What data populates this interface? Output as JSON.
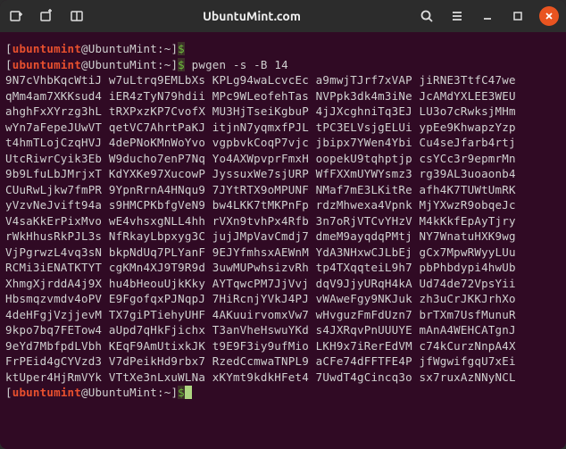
{
  "titlebar": {
    "title": "UbuntuMint.com"
  },
  "prompt": {
    "open": "[",
    "user": "ubuntumint",
    "at": "@",
    "host": "UbuntuMint",
    "colon": ":",
    "path": "~",
    "close": "]",
    "sigil": "$"
  },
  "command": " pwgen -s -B 14",
  "output_lines": [
    "9N7cVhbKqcWtiJ w7uLtrq9EMLbXs KPLg94waLcvcEc a9mwjTJrf7xVAP jiRNE3TtfC47we",
    "qMm4am7XKKsud4 iER4zTyN79hdii MPc9WLeofehTas NVPpk3dk4m3iNe JcAMdYXLEE3WEU",
    "ahghFxXYrzg3hL tRXPxzKP7CvofX MU3HjTseiKgbuP 4jJXcghniTq3EJ LU3o7cRwksjMHm",
    "wYn7aFepeJUwVT qetVC7AhrtPaKJ itjnN7yqmxfPJL tPC3ELVsjgELUi ypEe9KhwapzYzp",
    "t4hmTLojCzqHVJ 4dePNoKMnWoYvo vgpbvkCoqP7vjc jbipx7YWen4Ybi Cu4seJfarb4rtj",
    "UtcRiwrCyik3Eb W9ducho7enP7Nq Yo4AXWpvprFmxH oopekU9tqhptjp csYCc3r9epmrMn",
    "9b9LfuLbJMrjxT KdYXKe97XucowP JyssuxWe7sjURP WfFXXmUYWYsmz3 rg39AL3uoaonb4",
    "CUuRwLjkw7fmPR 9YpnRrnA4HNqu9 7JYtRTX9oMPUNF NMaf7mE3LKitRe afh4K7TUWtUmRK",
    "yVzvNeJvift94a s9HMCPKbfgVeN9 bw4LKK7tMKPnFp rdzMhwexa4Vpnk MjYXwzR9obqeJc",
    "V4saKkErPixMvo wE4vhsxgNLL4hh rVXn9tvhPx4Rfb 3n7oRjVTCvYHzV M4kKkfEpAyTjry",
    "rWkHhusRkPJL3s NfRkayLbpxyg3C jujJMpVavCmdj7 dmeM9ayqdqPMtj NY7WnatuHXK9wg",
    "VjPgrwzL4vq3sN bkpNdUq7PLYanF 9EJYfmhsxAEWnM YdA3NHxwCJLbEj gCx7MpwRWyyLUu",
    "RCMi3iENATKTYT cgKMn4XJ9T9R9d 3uwMUPwhsizvRh tp4TXqqteiL9h7 pbPhbdypi4hwUb",
    "XhmgXjrddA4j9X hu4bHeouUjkKky AYTqwcPM7JjVvj dqV9JjyURqH4kA Ud74de72VpsYii",
    "Hbsmqzvmdv4oPV E9FgofqxPJNqpJ 7HiRcnjYVkJ4PJ vWAweFgy9NKJuk zh3uCrJKKJrhXo",
    "4deHFgjVzjjevM TX7giPTiehyUHF 4AKuuirvomxVw7 wHvguzFmFdUzn7 brTXm7UsfMunuR",
    "9kpo7bq7FETow4 aUpd7qHkFjichx T3anVheHswuYKd s4JXRqvPnUUUYE mAnA4WEHCATgnJ",
    "9eYd7MbfpdLVbh KEqF9AmUtixkJK t9E9F3iy9ufMio LKH9x7iRerEdVM c74kCurzNnpA4X",
    "FrPEid4gCYVzd3 V7dPeikHd9rbx7 RzedCcmwaTNPL9 aCFe74dFFTFE4P jfWgwifgqU7xEi",
    "ktUper4HjRmVYk VTtXe3nLxuWLNa xKYmt9kdkHFet4 7UwdT4gCincq3o sx7ruxAzNNyNCL"
  ]
}
